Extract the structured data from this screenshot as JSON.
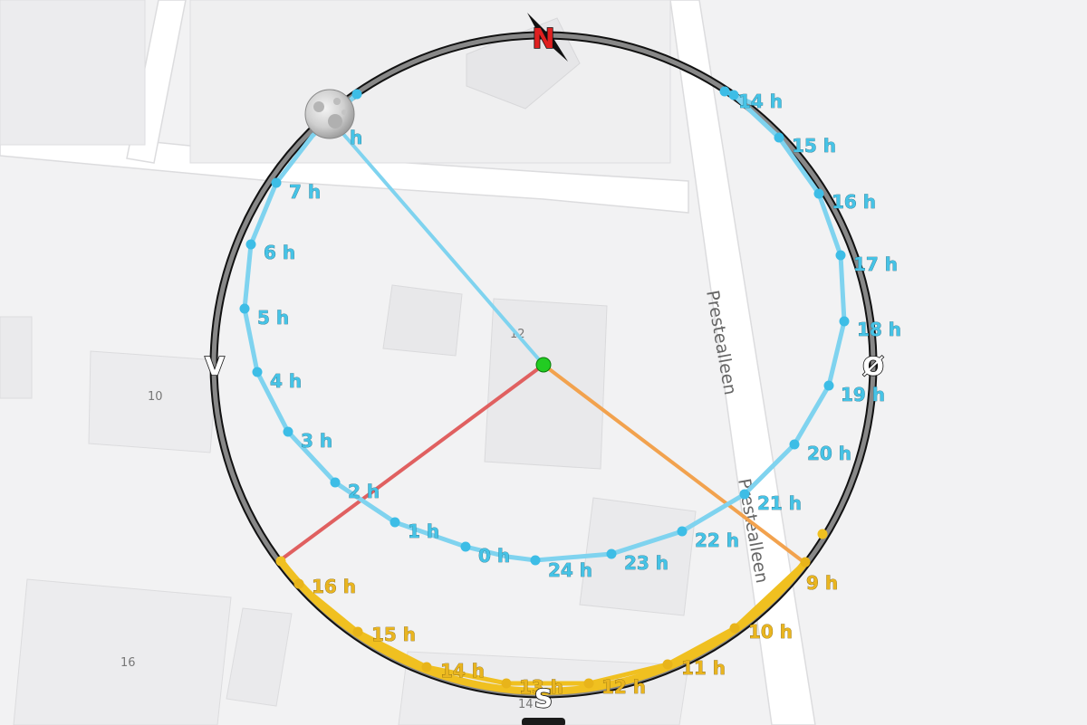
{
  "map": {
    "building_labels": [
      "12",
      "10",
      "16",
      "14"
    ],
    "street_name": "Prestealleen"
  },
  "compass": {
    "north": "N",
    "south": "S",
    "east": "Ø",
    "west": "V"
  },
  "moon_path": {
    "color": "#7fd3ef",
    "labels": [
      "0 h",
      "1 h",
      "2 h",
      "3 h",
      "4 h",
      "5 h",
      "6 h",
      "7 h",
      "h",
      "14 h",
      "15 h",
      "16 h",
      "17 h",
      "18 h",
      "19 h",
      "20 h",
      "21 h",
      "22 h",
      "23 h",
      "24 h"
    ]
  },
  "sun_path": {
    "color": "#f0c020",
    "labels": [
      "9 h",
      "10 h",
      "11 h",
      "12 h",
      "13 h",
      "14 h",
      "15 h",
      "16 h"
    ]
  },
  "rays": {
    "moon_color": "#7fd3ef",
    "sunset_color": "#e06060",
    "sunrise_color": "#f2a24e"
  },
  "center_marker_color": "#22cc22",
  "moon_icon": "full-moon-icon"
}
